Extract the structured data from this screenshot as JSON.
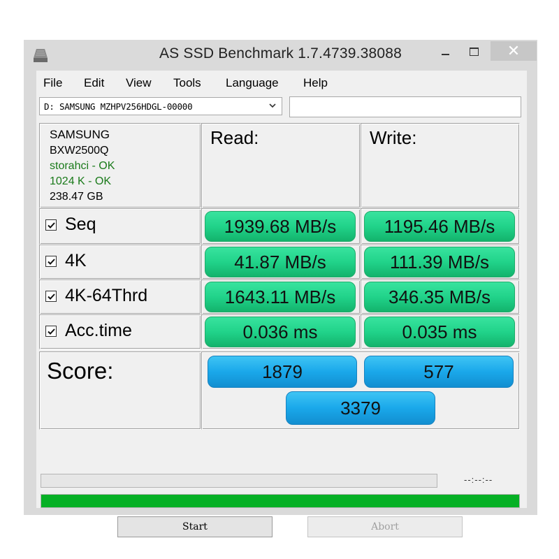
{
  "window": {
    "title": "AS SSD Benchmark 1.7.4739.38088",
    "close_glyph": "✕"
  },
  "menu": {
    "items": [
      "File",
      "Edit",
      "View",
      "Tools",
      "Language",
      "Help"
    ]
  },
  "drive": {
    "selected": "D: SAMSUNG MZHPV256HDGL-00000"
  },
  "info": {
    "vendor": "SAMSUNG",
    "firmware": "BXW2500Q",
    "driver_status": "storahci - OK",
    "alignment_status": "1024 K - OK",
    "capacity": "238.47 GB"
  },
  "headers": {
    "read": "Read:",
    "write": "Write:"
  },
  "tests": [
    {
      "label": "Seq",
      "checked": true,
      "read": "1939.68 MB/s",
      "write": "1195.46 MB/s"
    },
    {
      "label": "4K",
      "checked": true,
      "read": "41.87 MB/s",
      "write": "111.39 MB/s"
    },
    {
      "label": "4K-64Thrd",
      "checked": true,
      "read": "1643.11 MB/s",
      "write": "346.35 MB/s"
    },
    {
      "label": "Acc.time",
      "checked": true,
      "read": "0.036 ms",
      "write": "0.035 ms"
    }
  ],
  "score": {
    "label": "Score:",
    "read": "1879",
    "write": "577",
    "total": "3379"
  },
  "progress": {
    "timer": "--:--:--",
    "overall_fraction": 1.0
  },
  "buttons": {
    "start": "Start",
    "abort": "Abort"
  },
  "colors": {
    "result_green": "#21d38a",
    "score_blue": "#1aa8ea",
    "progress_green": "#06b025"
  }
}
